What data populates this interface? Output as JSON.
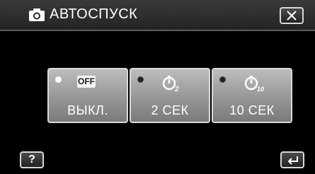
{
  "header": {
    "title": "АВТОСПУСК",
    "icon": "camera-icon"
  },
  "options": [
    {
      "badge": "OFF",
      "label": "ВЫКЛ.",
      "selected": true,
      "icon": "off-icon"
    },
    {
      "badge": "2",
      "label": "2 СЕК",
      "selected": false,
      "icon": "self-timer-2-icon"
    },
    {
      "badge": "10",
      "label": "10 СЕК",
      "selected": false,
      "icon": "self-timer-10-icon"
    }
  ],
  "footer": {
    "help_label": "?",
    "help_icon": "help-icon",
    "back_icon": "back-icon"
  },
  "close_icon": "close-icon",
  "colors": {
    "background": "#000000",
    "button_gradient_top": "#bdbdbd",
    "button_gradient_bottom": "#7a7a7a",
    "text": "#ffffff"
  }
}
